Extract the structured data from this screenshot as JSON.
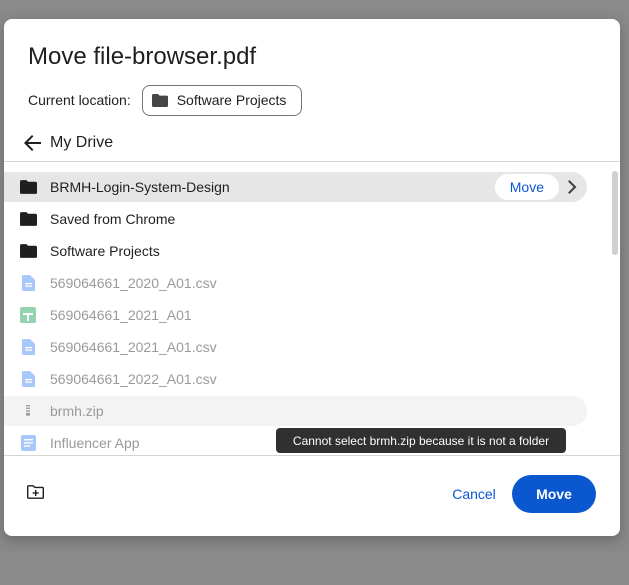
{
  "dialog": {
    "title": "Move file-browser.pdf",
    "current_location_label": "Current location:",
    "current_location_value": "Software Projects",
    "nav_title": "My Drive"
  },
  "items": [
    {
      "name": "BRMH-Login-System-Design",
      "kind": "folder",
      "icon": "folder-icon",
      "state": "selected",
      "action_label": "Move"
    },
    {
      "name": "Saved from Chrome",
      "kind": "folder",
      "icon": "folder-icon"
    },
    {
      "name": "Software Projects",
      "kind": "folder",
      "icon": "folder-icon"
    },
    {
      "name": "569064661_2020_A01.csv",
      "kind": "file",
      "icon": "doc-file-icon"
    },
    {
      "name": "569064661_2021_A01",
      "kind": "file",
      "icon": "sheets-icon"
    },
    {
      "name": "569064661_2021_A01.csv",
      "kind": "file",
      "icon": "doc-file-icon"
    },
    {
      "name": "569064661_2022_A01.csv",
      "kind": "file",
      "icon": "doc-file-icon"
    },
    {
      "name": "brmh.zip",
      "kind": "file",
      "icon": "zip-icon",
      "state": "hover"
    },
    {
      "name": "Influencer App",
      "kind": "file",
      "icon": "docs-icon"
    }
  ],
  "tooltip": "Cannot select brmh.zip because it is not a folder",
  "footer": {
    "cancel_label": "Cancel",
    "move_label": "Move"
  },
  "colors": {
    "accent": "#0b57d0",
    "selected_row": "#e6e6e6",
    "disabled_text": "#9a9a9a",
    "tooltip_bg": "#303030"
  }
}
